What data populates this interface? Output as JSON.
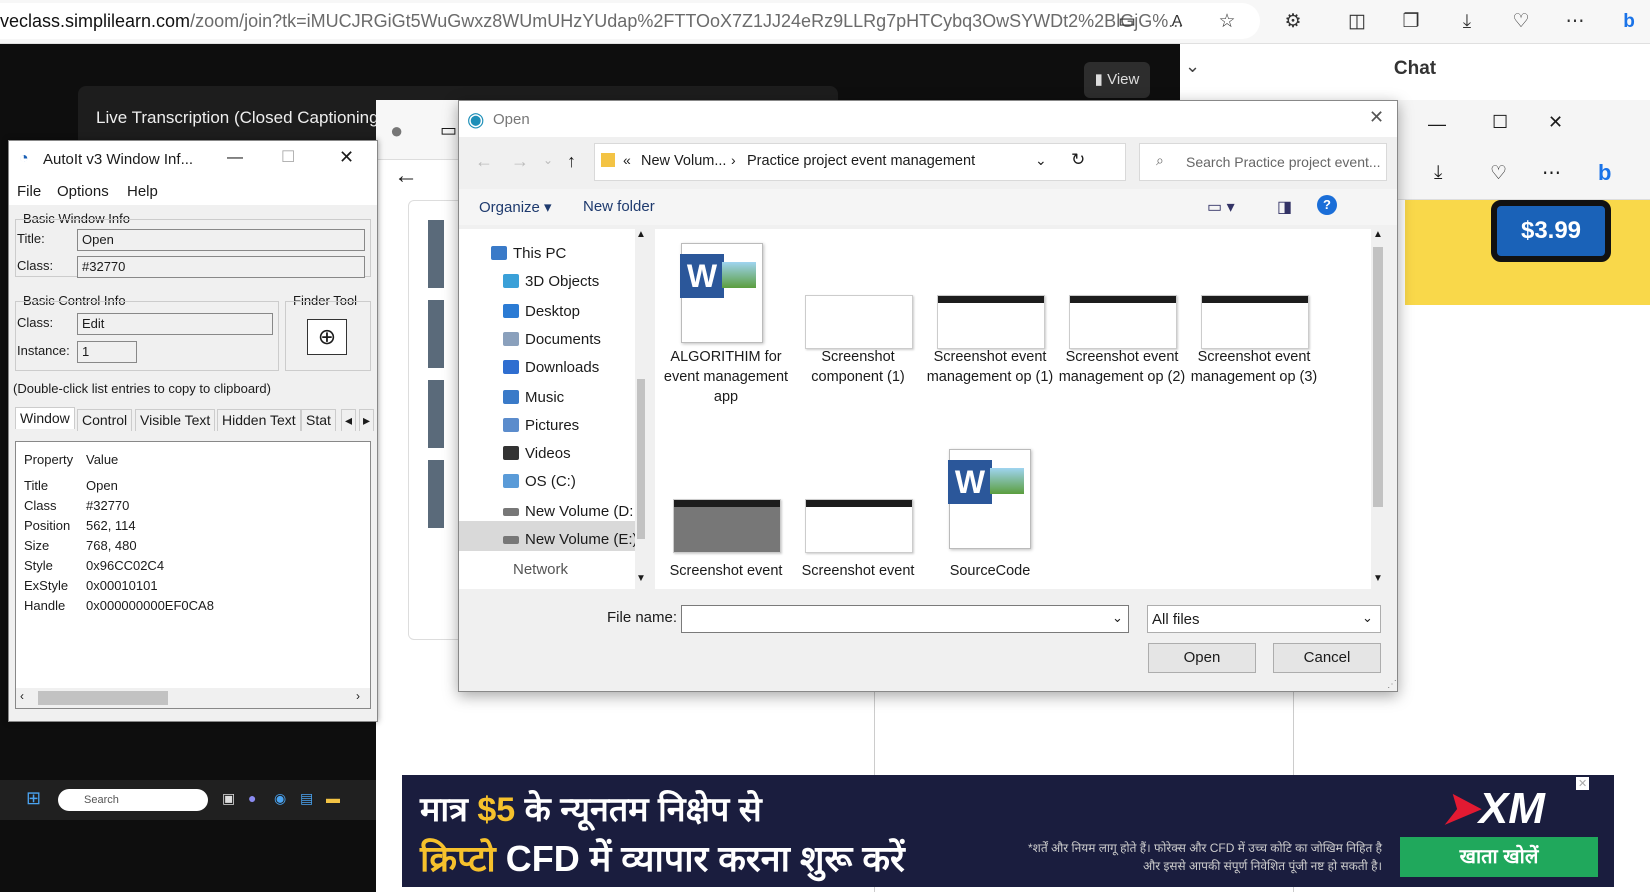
{
  "browser": {
    "url_host": "veclass.simplilearn.com",
    "url_path": "/zoom/join?tk=iMUCJRGiGt5WuGwxz8WUmUHzYUdap%2FTTOoX7Z1JJ24eRz9LLRg7pHTCybq3OwSYWDt2%2BlGjG%..."
  },
  "zoom": {
    "view_label": "View",
    "transcription": "Live Transcription (Closed Captioning",
    "chat_title": "Chat"
  },
  "ad_right": {
    "price": "$3.99"
  },
  "autoit": {
    "title": "AutoIt v3 Window Inf...",
    "menu": [
      "File",
      "Options",
      "Help"
    ],
    "basic_window_info": "Basic Window Info",
    "title_label": "Title:",
    "title_value": "Open",
    "class_label": "Class:",
    "class_value": "#32770",
    "basic_control_info": "Basic Control Info",
    "ctrl_class_label": "Class:",
    "ctrl_class_value": "Edit",
    "instance_label": "Instance:",
    "instance_value": "1",
    "finder_tool": "Finder Tool",
    "hint": "(Double-click list entries to copy to clipboard)",
    "tabs": [
      "Window",
      "Control",
      "Visible Text",
      "Hidden Text",
      "Stat"
    ],
    "prop_header": "Property",
    "value_header": "Value",
    "props": [
      {
        "k": "Title",
        "v": "Open"
      },
      {
        "k": "Class",
        "v": "#32770"
      },
      {
        "k": "Position",
        "v": "562, 114"
      },
      {
        "k": "Size",
        "v": "768, 480"
      },
      {
        "k": "Style",
        "v": "0x96CC02C4"
      },
      {
        "k": "ExStyle",
        "v": "0x00010101"
      },
      {
        "k": "Handle",
        "v": "0x000000000EF0CA8"
      }
    ]
  },
  "dialog": {
    "title": "Open",
    "breadcrumb": [
      "New Volum...",
      "Practice project event management"
    ],
    "search_placeholder": "Search Practice project event...",
    "organize": "Organize",
    "new_folder": "New folder",
    "nav": [
      "This PC",
      "3D Objects",
      "Desktop",
      "Documents",
      "Downloads",
      "Music",
      "Pictures",
      "Videos",
      "OS (C:)",
      "New Volume (D:",
      "New Volume (E:)",
      "Network"
    ],
    "files": [
      {
        "name": "ALGORITHIM for event management app",
        "kind": "word"
      },
      {
        "name": "Screenshot component (1)",
        "kind": "shot"
      },
      {
        "name": "Screenshot event management op (1)",
        "kind": "shot"
      },
      {
        "name": "Screenshot event management op (2)",
        "kind": "shot"
      },
      {
        "name": "Screenshot event management op (3)",
        "kind": "shot"
      },
      {
        "name": "Screenshot event",
        "kind": "shot"
      },
      {
        "name": "Screenshot event",
        "kind": "shot"
      },
      {
        "name": "SourceCode",
        "kind": "word"
      }
    ],
    "filename_label": "File name:",
    "filename_value": "",
    "filter": "All files",
    "open_btn": "Open",
    "cancel_btn": "Cancel"
  },
  "taskbar": {
    "search": "Search"
  },
  "ad_bottom": {
    "line1_a": "मात्र",
    "line1_b": "$5",
    "line1_c": "के न्यूनतम निक्षेप से",
    "line2_a": "क्रिप्टो",
    "line2_b": "CFD में व्यापार करना शुरू करें",
    "fine": "*शर्तें और नियम लागू होते हैं। फोरेक्स और CFD में उच्च कोटि का जोखिम निहित है और इससे आपकी संपूर्ण निवेशित पूंजी नष्ट हो सकती है।",
    "cta": "खाता खोलें",
    "brand": "XM"
  }
}
